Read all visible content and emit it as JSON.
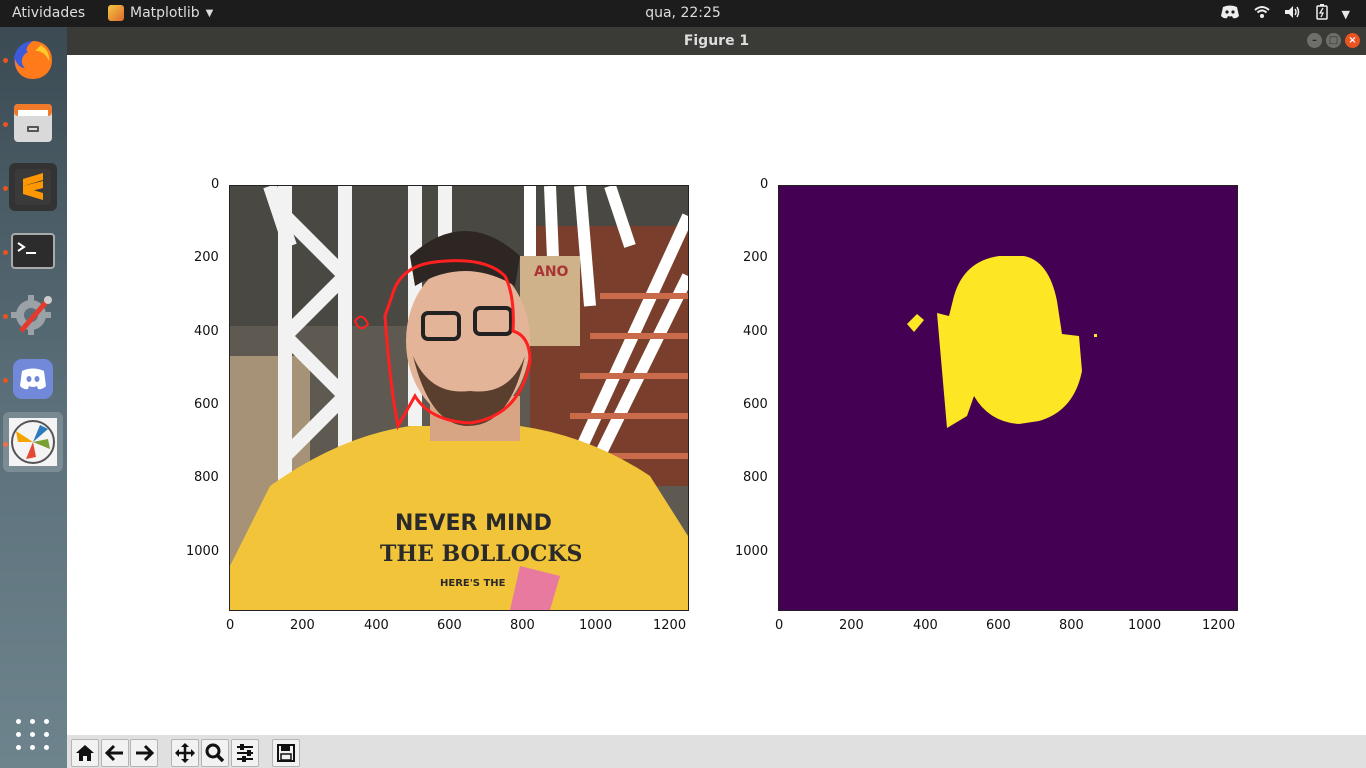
{
  "topbar": {
    "activities": "Atividades",
    "app_name": "Matplotlib",
    "clock": "qua, 22:25",
    "tray_icons": [
      "discord-icon",
      "wifi-icon",
      "volume-icon",
      "battery-icon",
      "power-menu-icon"
    ]
  },
  "window": {
    "title": "Figure 1"
  },
  "dock": {
    "items": [
      "firefox",
      "files",
      "sublime-text",
      "terminal",
      "settings-tool",
      "discord",
      "matplotlib-figure"
    ],
    "apps_label": "Show Applications"
  },
  "figure": {
    "left_image": {
      "description_type": "image",
      "xticks": [
        "0",
        "200",
        "400",
        "600",
        "800",
        "1000",
        "1200"
      ],
      "yticks": [
        "0",
        "200",
        "400",
        "600",
        "800",
        "1000"
      ],
      "shirt_line1": "NEVER MIND",
      "shirt_line2": "THE BOLLOCKS",
      "shirt_line3": "HERE'S THE",
      "box_text": "ANO"
    },
    "right_image": {
      "xticks": [
        "0",
        "200",
        "400",
        "600",
        "800",
        "1000",
        "1200"
      ],
      "yticks": [
        "0",
        "200",
        "400",
        "600",
        "800",
        "1000"
      ],
      "background_color": "#440154",
      "mask_color": "#fde725"
    }
  },
  "toolbar": {
    "buttons": [
      "home",
      "back",
      "forward",
      "pan",
      "zoom",
      "configure-subplots",
      "save"
    ]
  },
  "colors": {
    "accent": "#e95420",
    "contour": "#ff2020"
  }
}
